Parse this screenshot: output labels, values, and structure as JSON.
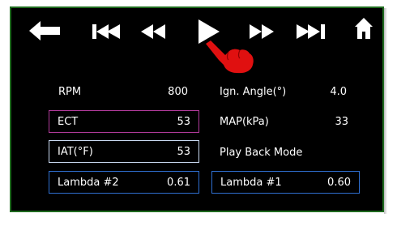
{
  "toolbar": {
    "back_icon": "back-arrow-icon",
    "skip_back_icon": "skip-to-start-icon",
    "rewind_icon": "rewind-icon",
    "play_icon": "play-icon",
    "fast_forward_icon": "fast-forward-icon",
    "skip_forward_icon": "skip-to-end-icon",
    "home_icon": "home-icon",
    "cursor_icon": "pointing-hand-cursor-icon"
  },
  "readouts": {
    "rpm": {
      "label": "RPM",
      "value": "800"
    },
    "ign_angle": {
      "label": "Ign. Angle(°)",
      "value": "4.0"
    },
    "ect": {
      "label": "ECT",
      "value": "53"
    },
    "map": {
      "label": "MAP(kPa)",
      "value": "33"
    },
    "iat": {
      "label": "IAT(°F)",
      "value": "53"
    },
    "mode": {
      "label": "Play Back Mode"
    },
    "lambda2": {
      "label": "Lambda #2",
      "value": "0.61"
    },
    "lambda1": {
      "label": "Lambda #1",
      "value": "0.60"
    }
  },
  "colors": {
    "screen_bg": "#000000",
    "frame": "#1f6b1f",
    "ect_border": "#b03a9a",
    "iat_border": "#c8d8f0",
    "lambda_border": "#2f6fd0",
    "cursor": "#e01010"
  }
}
